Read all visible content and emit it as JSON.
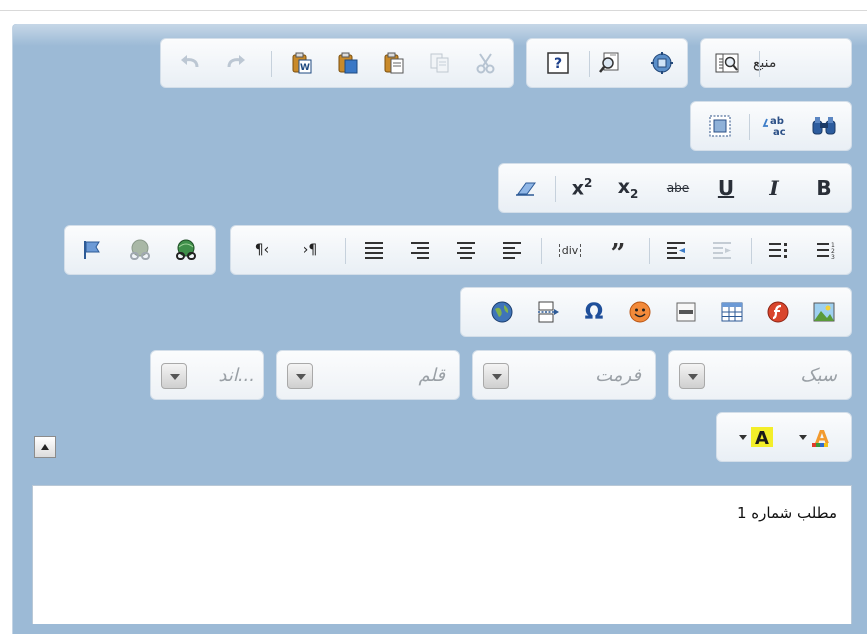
{
  "toolbar": {
    "source_label": "منبع",
    "styles_value": "سبک",
    "format_value": "فرمت",
    "font_value": "قلم",
    "size_value": "...اند"
  },
  "icons": {
    "source": "document-source-icon",
    "preview": "preview-magnifier-icon",
    "templates": "templates-icon",
    "check-spelling": "spellcheck-icon",
    "help": "help-question-icon",
    "cut": "scissors-icon",
    "copy": "copy-icon",
    "paste": "paste-icon",
    "paste-text": "paste-text-icon",
    "paste-word": "paste-word-icon",
    "redo": "redo-arrow-icon",
    "undo": "undo-arrow-icon"
  },
  "content": {
    "body_text": "مطلب شماره 1"
  },
  "colors": {
    "editor_bg": "#9cbad6",
    "toolbar_group_bg": "#eef2f6",
    "icon_blue": "#2a4a78"
  }
}
